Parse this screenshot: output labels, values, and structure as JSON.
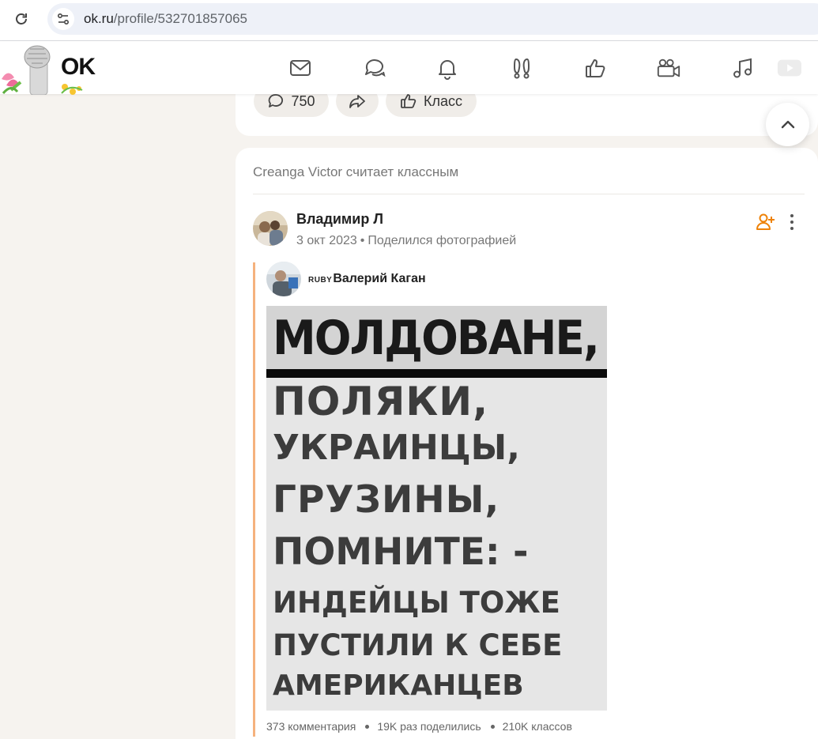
{
  "browser": {
    "url_host": "ok.ru",
    "url_path": "/profile/532701857065"
  },
  "header": {
    "logo_text": "OK",
    "nav": [
      {
        "name": "messages-icon"
      },
      {
        "name": "discussions-icon"
      },
      {
        "name": "notifications-icon"
      },
      {
        "name": "guests-icon"
      },
      {
        "name": "likes-icon"
      },
      {
        "name": "video-icon"
      },
      {
        "name": "music-icon"
      },
      {
        "name": "video-play-icon"
      }
    ]
  },
  "prev_post": {
    "comments_count": "750",
    "like_label": "Класс"
  },
  "activity": {
    "text": "Creanga Victor считает классным"
  },
  "post": {
    "author": "Владимир Л",
    "date": "3 окт 2023",
    "action": "Поделился фотографией",
    "original_badge": "RUBY",
    "original_author": "Валерий Каган",
    "photo_lines": [
      "МОЛДОВАНЕ,",
      "ПОЛЯКИ,",
      "УКРАИНЦЫ,",
      "ГРУЗИНЫ,",
      "ПОМНИТЕ: -",
      "ИНДЕЙЦЫ ТОЖЕ",
      "ПУСТИЛИ К СЕБЕ",
      "АМЕРИКАНЦЕВ"
    ],
    "stats": {
      "comments": "373 комментария",
      "shares": "19K раз поделились",
      "likes": "210K классов"
    }
  },
  "colors": {
    "accent": "#ee8208",
    "quote_bar": "#f5b27d",
    "page_bg": "#f6f3ef"
  }
}
